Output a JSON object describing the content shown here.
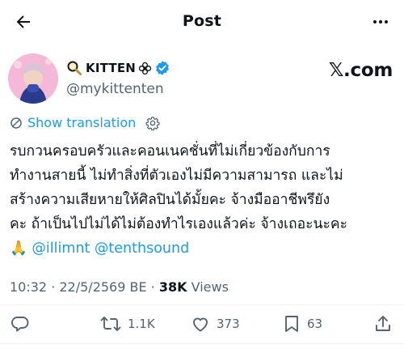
{
  "header": {
    "title": "Post"
  },
  "author": {
    "display_name": "KITTEN",
    "handle": "@mykittenten",
    "platform_badge": "𝕏.com",
    "verified_color": "#1d9bf0"
  },
  "translation": {
    "label": "Show translation"
  },
  "tweet": {
    "lines": [
      "รบกวนครอบครัวและคอนเนคชั่นที่ไม่เกี่ยวข้องกับการ",
      "ทำงานสายนี้ ไม่ทำสิ่งที่ตัวเองไม่มีความสามารถ และไม่",
      "สร้างความเสียหายให้ศิลปินได้มั้ยคะ จ้างมืออาชีพรึยัง",
      "คะ ถ้าเป็นไปไม่ได้ไม่ต้องทำไรเองแล้วค่ะ จ้างเถอะนะคะ"
    ],
    "prayer_emoji": "🙏",
    "mentions": [
      "@illimnt",
      "@tenthsound"
    ]
  },
  "meta": {
    "time": "10:32",
    "separator": " · ",
    "date": "22/5/2569 BE",
    "views_count": "38K",
    "views_label": " Views"
  },
  "actions": {
    "reply": "",
    "retweet": "1.1K",
    "like": "373",
    "bookmark": "63"
  },
  "colors": {
    "accent": "#1d9bf0",
    "muted": "#536471",
    "text": "#0f1419"
  },
  "icons": [
    "back-arrow-icon",
    "more-icon",
    "magnifier-icon",
    "flower-icon",
    "verified-icon",
    "settings-icon",
    "reply-icon",
    "retweet-icon",
    "like-icon",
    "bookmark-icon",
    "share-icon"
  ]
}
